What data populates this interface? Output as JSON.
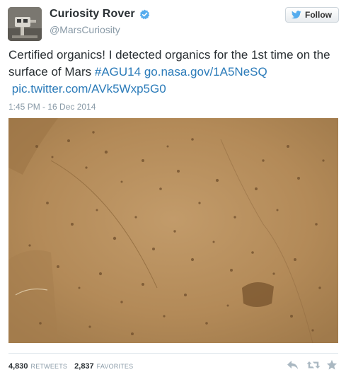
{
  "user": {
    "name": "Curiosity Rover",
    "handle": "@MarsCuriosity",
    "verified_icon": "verified-badge-icon",
    "avatar_icon": "rover-avatar"
  },
  "follow": {
    "label": "Follow",
    "icon": "twitter-bird-icon"
  },
  "tweet": {
    "text_plain": "Certified organics! I detected organics for the 1st time on the surface of Mars",
    "hashtag": "#AGU14",
    "link": "go.nasa.gov/1A5NeSQ",
    "pic_link": "pic.twitter.com/AVk5Wxp5G0",
    "timestamp": "1:45 PM - 16 Dec 2014"
  },
  "stats": {
    "retweets_count": "4,830",
    "retweets_label": "RETWEETS",
    "favorites_count": "2,837",
    "favorites_label": "FAVORITES"
  },
  "actions": [
    {
      "icon": "reply-icon"
    },
    {
      "icon": "retweet-icon"
    },
    {
      "icon": "favorite-star-icon"
    }
  ],
  "colors": {
    "link": "#2b7bb9",
    "muted": "#8899a6",
    "text": "#292f33",
    "verified": "#55acee",
    "mars_surface": "#b48d5e"
  }
}
